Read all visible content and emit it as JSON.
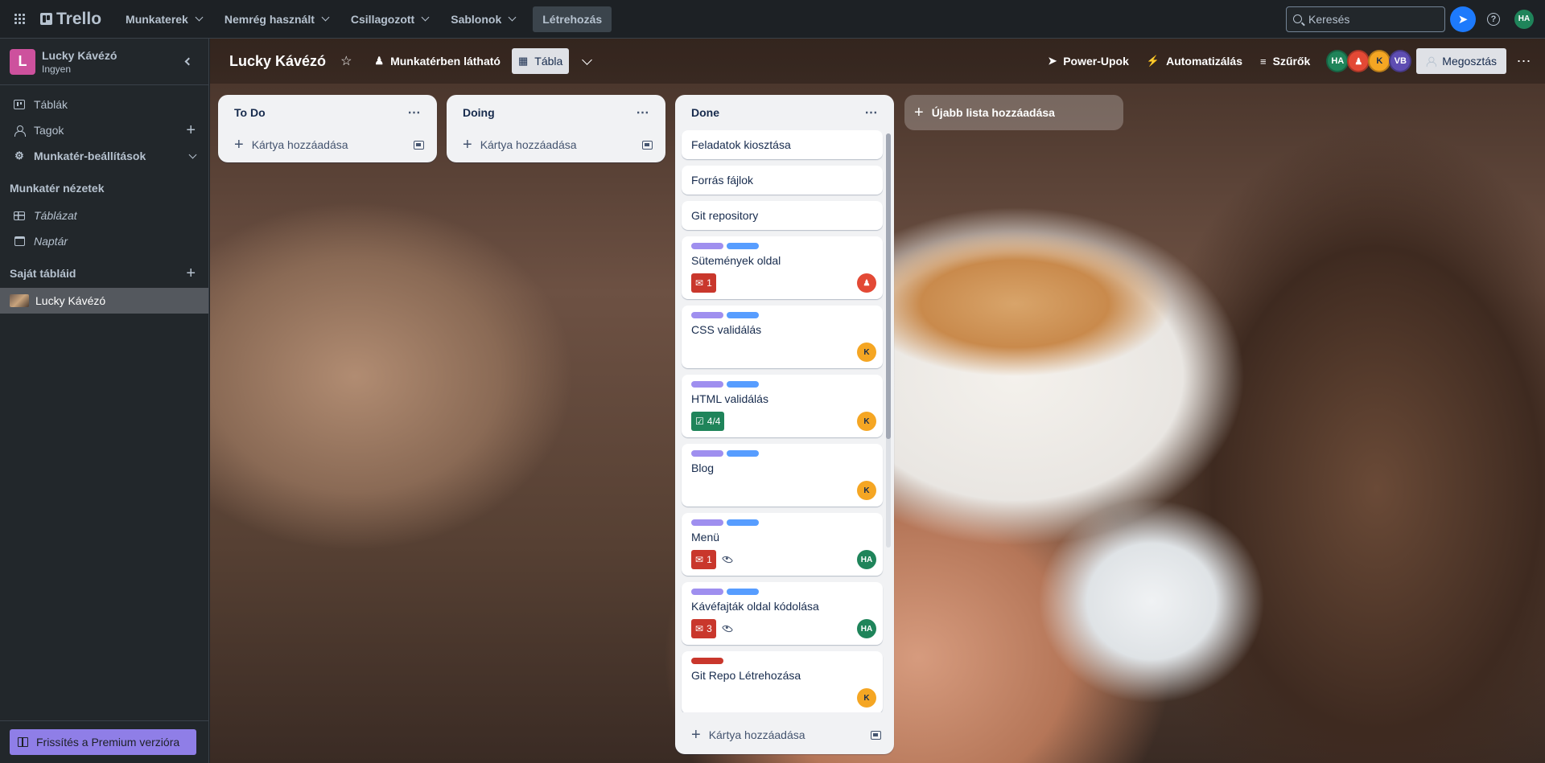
{
  "topnav": {
    "logo": "Trello",
    "menus": [
      "Munkaterek",
      "Nemrég használt",
      "Csillagozott",
      "Sablonok"
    ],
    "create": "Létrehozás",
    "search_placeholder": "Keresés",
    "user_initials": "HA"
  },
  "sidebar": {
    "workspace_initial": "L",
    "workspace_name": "Lucky Kávézó",
    "workspace_plan": "Ingyen",
    "items": {
      "boards": "Táblák",
      "members": "Tagok",
      "settings": "Munkatér-beállítások"
    },
    "views_title": "Munkatér nézetek",
    "views": {
      "table": "Táblázat",
      "calendar": "Naptár"
    },
    "my_boards_title": "Saját tábláid",
    "current_board": "Lucky Kávézó",
    "upgrade": "Frissítés a Premium verzióra"
  },
  "board": {
    "title": "Lucky Kávézó",
    "visibility": "Munkatérben látható",
    "view": "Tábla",
    "powerups": "Power-Upok",
    "automation": "Automatizálás",
    "filters": "Szűrők",
    "members": {
      "m1": "HA",
      "m3": "K",
      "m4": "VB"
    },
    "share": "Megosztás",
    "add_list": "Újabb lista hozzáadása"
  },
  "lists": {
    "todo": {
      "title": "To Do",
      "add_card": "Kártya hozzáadása"
    },
    "doing": {
      "title": "Doing",
      "add_card": "Kártya hozzáadása"
    },
    "done": {
      "title": "Done",
      "add_card": "Kártya hozzáadása",
      "cards": {
        "c1": {
          "title": "Feladatok kiosztása"
        },
        "c2": {
          "title": "Forrás fájlok"
        },
        "c3": {
          "title": "Git repository"
        },
        "c4": {
          "title": "Sütemények oldal",
          "badge": "1"
        },
        "c5": {
          "title": "CSS validálás",
          "member": "K"
        },
        "c6": {
          "title": "HTML validálás",
          "checklist": "4/4",
          "member": "K"
        },
        "c7": {
          "title": "Blog",
          "member": "K"
        },
        "c8": {
          "title": "Menü",
          "badge": "1",
          "member": "HA"
        },
        "c9": {
          "title": "Kávéfajták oldal kódolása",
          "badge": "3",
          "member": "HA"
        },
        "c10": {
          "title": "Git Repo Létrehozása",
          "member": "K"
        }
      }
    }
  },
  "colors": {
    "label_purple": "#9f8fef",
    "label_blue": "#579dff",
    "label_red": "#c9372c",
    "badge_green": "#1f845a",
    "accent": "#1d7afc"
  }
}
